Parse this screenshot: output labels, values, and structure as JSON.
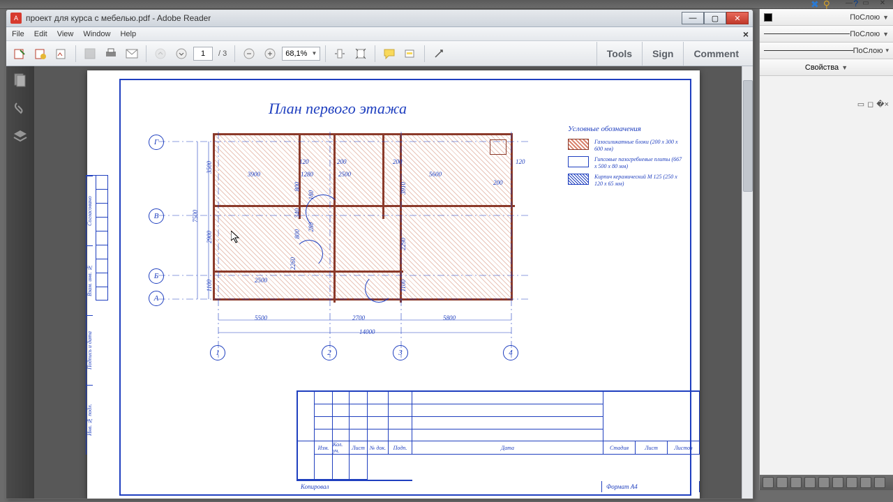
{
  "outer": {
    "help": "?"
  },
  "reader": {
    "title": "проект для курса с мебелью.pdf - Adobe Reader",
    "menu": [
      "File",
      "Edit",
      "View",
      "Window",
      "Help"
    ],
    "toolbar": {
      "page_current": "1",
      "page_total": "/ 3",
      "zoom": "68,1%"
    },
    "right_actions": [
      "Tools",
      "Sign",
      "Comment"
    ]
  },
  "drawing": {
    "title": "План первого этажа",
    "axes_v": [
      "Г",
      "В",
      "Б",
      "А"
    ],
    "axes_h": [
      "1",
      "2",
      "3",
      "4"
    ],
    "dims": {
      "top_inside": [
        "3900",
        "1280",
        "2500",
        "5600"
      ],
      "top_small": [
        "120",
        "200",
        "200",
        "120",
        "200"
      ],
      "left": [
        "3500",
        "2900",
        "1100",
        "7500"
      ],
      "internal_v": [
        "800",
        "340",
        "800",
        "180",
        "2260",
        "280"
      ],
      "right_v": [
        "3910",
        "2290",
        "1100"
      ],
      "bottom_inside": [
        "2500"
      ],
      "bottom": [
        "5500",
        "2700",
        "5800"
      ],
      "overall": "14000"
    },
    "legend": {
      "title": "Условные обозначения",
      "items": [
        {
          "swatch": "hatch1",
          "text": "Газосиликатные блоки (200 x 300 x 600 мм)"
        },
        {
          "swatch": "blank",
          "text": "Гипсовые пазогребневые плиты (667 x 500 x 80 мм)"
        },
        {
          "swatch": "hatch2",
          "text": "Кирпич керамический М 125 (250 x 120 x 65 мм)"
        }
      ]
    },
    "stamp": {
      "side": [
        "Согласовано",
        "Взам. инв. №",
        "Подпись и дата",
        "Инв. № подл."
      ],
      "cols": [
        "Изм.",
        "Кол. уч.",
        "Лист",
        "№ док.",
        "Подп.",
        "Дата"
      ],
      "right_cols": [
        "Стадия",
        "Лист",
        "Листов"
      ],
      "footer": [
        "Копировал",
        "Формат А4"
      ]
    }
  },
  "cad": {
    "rows": [
      "ПоСлою",
      "ПоСлою",
      "ПоСлою"
    ],
    "props": "Свойства"
  }
}
